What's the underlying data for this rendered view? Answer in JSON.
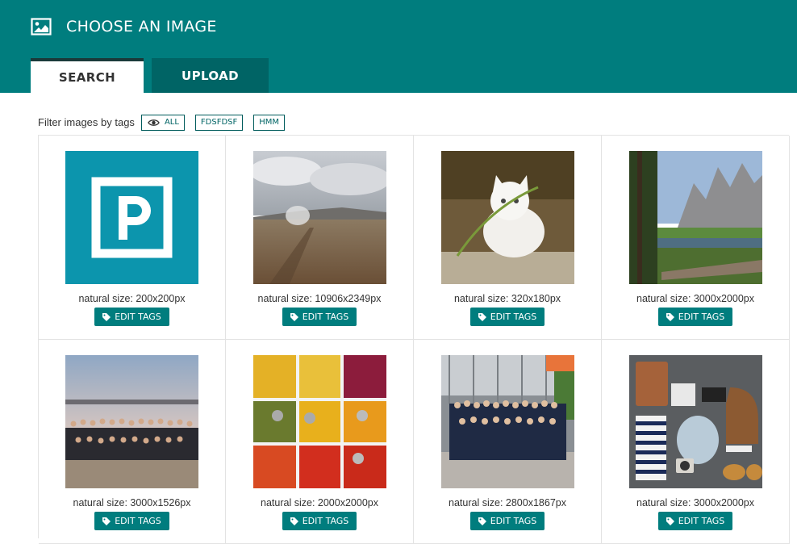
{
  "header": {
    "title": "CHOOSE AN IMAGE",
    "icon": "image-icon"
  },
  "tabs": [
    {
      "label": "SEARCH",
      "active": true
    },
    {
      "label": "UPLOAD",
      "active": false
    }
  ],
  "filter": {
    "label": "Filter images by tags",
    "tags": [
      "ALL",
      "FDSFDSF",
      "HMM"
    ]
  },
  "images": [
    {
      "natural_size": "natural size: 200x200px",
      "edit_label": "EDIT TAGS",
      "subject": "parking sign"
    },
    {
      "natural_size": "natural size: 10906x2349px",
      "edit_label": "EDIT TAGS",
      "subject": "volcanic landscape"
    },
    {
      "natural_size": "natural size: 320x180px",
      "edit_label": "EDIT TAGS",
      "subject": "white kitten"
    },
    {
      "natural_size": "natural size: 3000x2000px",
      "edit_label": "EDIT TAGS",
      "subject": "yosemite valley"
    },
    {
      "natural_size": "natural size: 3000x1526px",
      "edit_label": "EDIT TAGS",
      "subject": "group photo at dusk"
    },
    {
      "natural_size": "natural size: 2000x2000px",
      "edit_label": "EDIT TAGS",
      "subject": "spices"
    },
    {
      "natural_size": "natural size: 2800x1867px",
      "edit_label": "EDIT TAGS",
      "subject": "team photo"
    },
    {
      "natural_size": "natural size: 3000x2000px",
      "edit_label": "EDIT TAGS",
      "subject": "travel items"
    }
  ],
  "colors": {
    "brand": "#007d7e",
    "tab_inactive": "#006465"
  }
}
